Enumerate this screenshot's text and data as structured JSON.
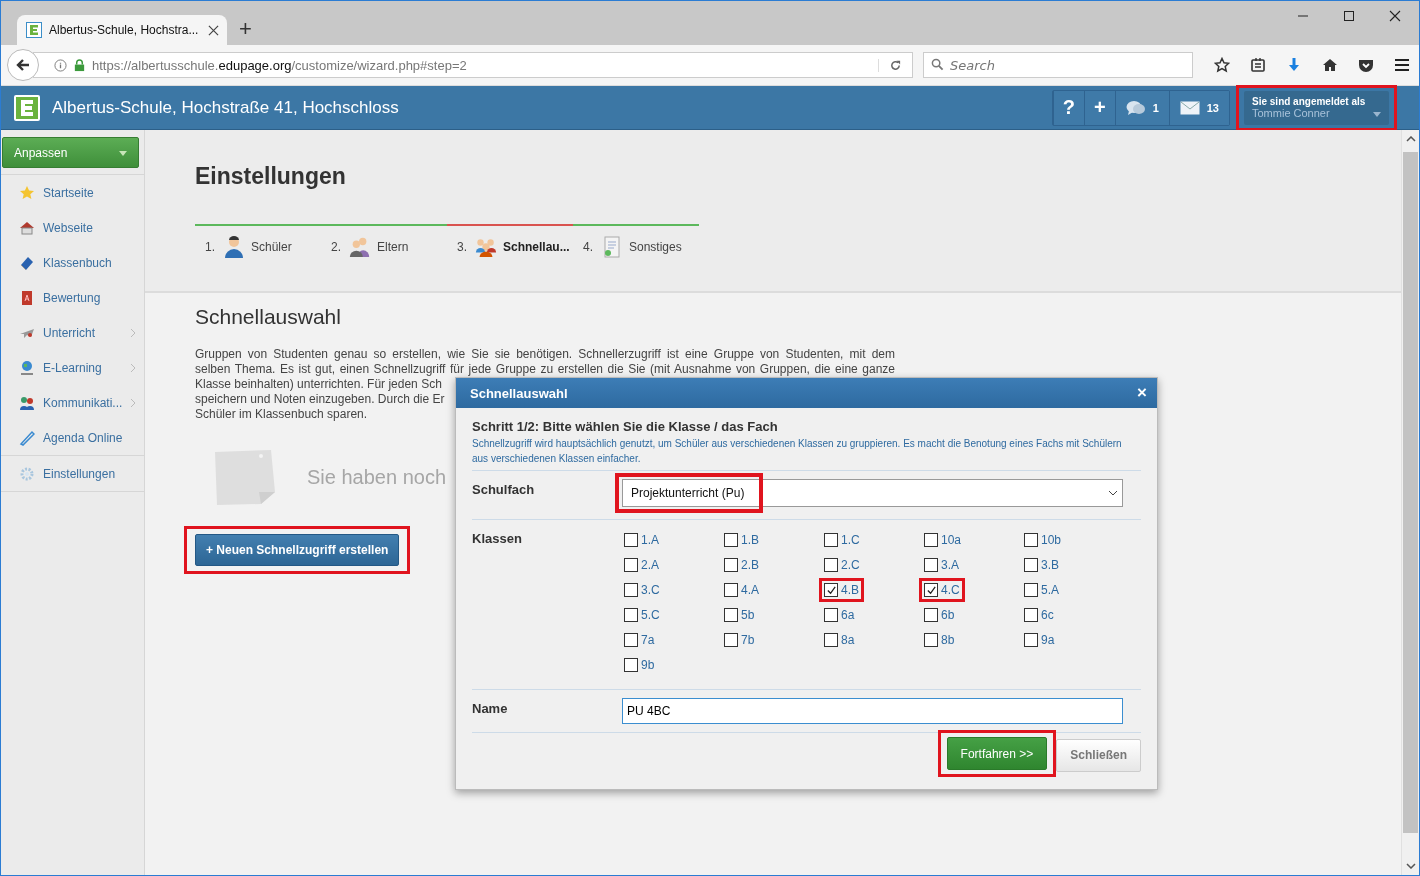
{
  "browser": {
    "tab_title": "Albertus-Schule, Hochstra...",
    "new_tab": "+",
    "url": {
      "scheme": "https://albertusschule.",
      "domain": "edupage.org",
      "path": "/customize/wizard.php#step=2"
    },
    "search": {
      "placeholder": "Search"
    }
  },
  "header": {
    "school": "Albertus-Schule, Hochstraße 41, Hochschloss",
    "help": "?",
    "add": "+",
    "messages_count": "1",
    "mail_count": "13",
    "user": {
      "label": "Sie sind angemeldet als",
      "name": "Tommie Conner",
      "highlighted": true
    }
  },
  "sidebar": {
    "menu_button": "Anpassen",
    "items": [
      {
        "label": "Startseite",
        "kind": "star",
        "submenu": false,
        "separated": false
      },
      {
        "label": "Webseite",
        "kind": "house",
        "submenu": false,
        "separated": false
      },
      {
        "label": "Klassenbuch",
        "kind": "book",
        "submenu": false,
        "separated": false
      },
      {
        "label": "Bewertung",
        "kind": "grade",
        "submenu": false,
        "separated": false
      },
      {
        "label": "Unterricht",
        "kind": "plane",
        "submenu": true,
        "separated": false
      },
      {
        "label": "E-Learning",
        "kind": "globe",
        "submenu": true,
        "separated": false
      },
      {
        "label": "Kommunikati...",
        "kind": "people",
        "submenu": true,
        "separated": false
      },
      {
        "label": "Agenda Online",
        "kind": "pen",
        "submenu": false,
        "separated": false
      },
      {
        "label": "Einstellungen",
        "kind": "gear",
        "submenu": false,
        "separated": true
      }
    ]
  },
  "page": {
    "title": "Einstellungen",
    "steps": [
      {
        "number": "1.",
        "label": "Schüler",
        "selected": false,
        "color": "#5cb85c",
        "kind": "single"
      },
      {
        "number": "2.",
        "label": "Eltern",
        "selected": false,
        "color": "#5cb85c",
        "kind": "pair"
      },
      {
        "number": "3.",
        "label": "Schnellau...",
        "selected": true,
        "color": "#d9534f",
        "kind": "group"
      },
      {
        "number": "4.",
        "label": "Sonstiges",
        "selected": false,
        "color": "#5cb85c",
        "kind": "sheet"
      }
    ],
    "section_title": "Schnellauswahl",
    "paragraph_lines": [
      "Gruppen von Studenten genau so erstellen, wie Sie sie benötigen. Schnellerzugriff ist eine Gruppe von Studenten, mit dem",
      "selben Thema. Es ist gut, einen Schnellzugriff für jede Gruppe zu erstellen die Sie (mit Ausnahme von Gruppen, die eine ganze",
      "Klasse beinhalten) unterrichten. Für jeden Sch",
      "speichern und Noten einzugeben. Durch die Er",
      "Schüler im Klassenbuch sparen."
    ],
    "empty_text": "Sie haben noch",
    "new_button": {
      "label": "+ Neuen Schnellzugriff erstellen",
      "highlighted": true
    }
  },
  "dialog": {
    "title": "Schnellauswahl",
    "close": "×",
    "step_title": "Schritt 1/2: Bitte wählen Sie die Klasse / das Fach",
    "hint": "Schnellzugriff wird hauptsächlich genutzt, um Schüler aus verschiedenen Klassen zu gruppieren. Es macht die Benotung eines Fachs mit Schülern aus verschiedenen Klassen einfacher.",
    "subject_label": "Schulfach",
    "subject": {
      "value": "Projektunterricht (Pu)",
      "highlighted": true
    },
    "classes_label": "Klassen",
    "classes": [
      {
        "label": "1.A",
        "checked": false,
        "highlighted": false
      },
      {
        "label": "1.B",
        "checked": false,
        "highlighted": false
      },
      {
        "label": "1.C",
        "checked": false,
        "highlighted": false
      },
      {
        "label": "10a",
        "checked": false,
        "highlighted": false
      },
      {
        "label": "10b",
        "checked": false,
        "highlighted": false
      },
      {
        "label": "2.A",
        "checked": false,
        "highlighted": false
      },
      {
        "label": "2.B",
        "checked": false,
        "highlighted": false
      },
      {
        "label": "2.C",
        "checked": false,
        "highlighted": false
      },
      {
        "label": "3.A",
        "checked": false,
        "highlighted": false
      },
      {
        "label": "3.B",
        "checked": false,
        "highlighted": false
      },
      {
        "label": "3.C",
        "checked": false,
        "highlighted": false
      },
      {
        "label": "4.A",
        "checked": false,
        "highlighted": false
      },
      {
        "label": "4.B",
        "checked": true,
        "highlighted": true
      },
      {
        "label": "4.C",
        "checked": true,
        "highlighted": true
      },
      {
        "label": "5.A",
        "checked": false,
        "highlighted": false
      },
      {
        "label": "5.C",
        "checked": false,
        "highlighted": false
      },
      {
        "label": "5b",
        "checked": false,
        "highlighted": false
      },
      {
        "label": "6a",
        "checked": false,
        "highlighted": false
      },
      {
        "label": "6b",
        "checked": false,
        "highlighted": false
      },
      {
        "label": "6c",
        "checked": false,
        "highlighted": false
      },
      {
        "label": "7a",
        "checked": false,
        "highlighted": false
      },
      {
        "label": "7b",
        "checked": false,
        "highlighted": false
      },
      {
        "label": "8a",
        "checked": false,
        "highlighted": false
      },
      {
        "label": "8b",
        "checked": false,
        "highlighted": false
      },
      {
        "label": "9a",
        "checked": false,
        "highlighted": false
      },
      {
        "label": "9b",
        "checked": false,
        "highlighted": false
      }
    ],
    "name_label": "Name",
    "name_value": "PU 4BC",
    "continue": {
      "label": "Fortfahren >>",
      "highlighted": true
    },
    "close_button": "Schließen"
  }
}
